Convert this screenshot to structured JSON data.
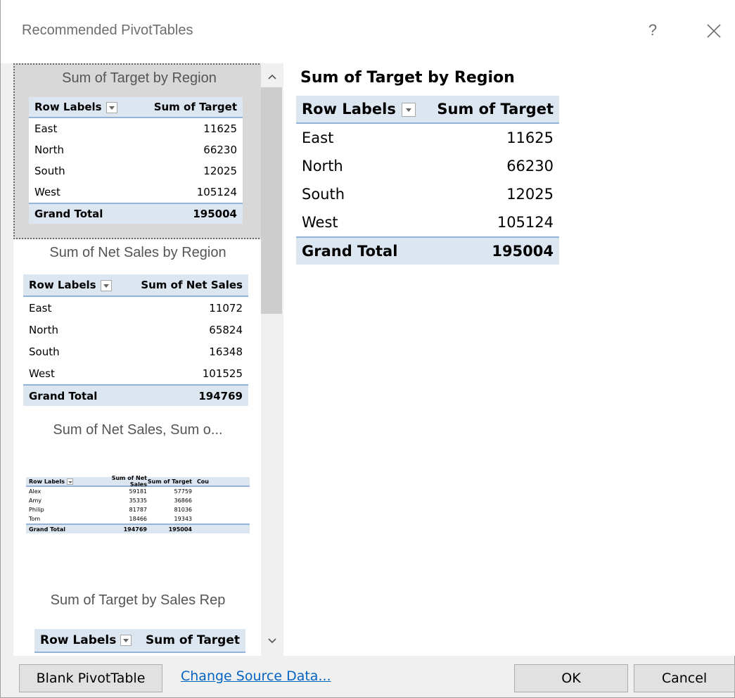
{
  "dialog": {
    "title": "Recommended PivotTables",
    "help_label": "?"
  },
  "gallery": {
    "cards": [
      {
        "title": "Sum of Target by Region",
        "header": [
          "Row Labels",
          "Sum of Target"
        ],
        "rows": [
          [
            "East",
            "11625"
          ],
          [
            "North",
            "66230"
          ],
          [
            "South",
            "12025"
          ],
          [
            "West",
            "105124"
          ]
        ],
        "total": [
          "Grand Total",
          "195004"
        ]
      },
      {
        "title": "Sum of Net Sales by Region",
        "header": [
          "Row Labels",
          "Sum of Net Sales"
        ],
        "rows": [
          [
            "East",
            "11072"
          ],
          [
            "North",
            "65824"
          ],
          [
            "South",
            "16348"
          ],
          [
            "West",
            "101525"
          ]
        ],
        "total": [
          "Grand Total",
          "194769"
        ]
      },
      {
        "title": "Sum of Net Sales, Sum o...",
        "header": [
          "Row Labels",
          "Sum of Net Sales",
          "Sum of Target",
          "Cou"
        ],
        "rows": [
          [
            "Alex",
            "59181",
            "57759"
          ],
          [
            "Amy",
            "35335",
            "36866"
          ],
          [
            "Philip",
            "81787",
            "81036"
          ],
          [
            "Tom",
            "18466",
            "19343"
          ]
        ],
        "total": [
          "Grand Total",
          "194769",
          "195004"
        ]
      },
      {
        "title": "Sum of Target by Sales Rep",
        "header": [
          "Row Labels",
          "Sum of Target"
        ]
      }
    ]
  },
  "preview": {
    "title": "Sum of Target by Region",
    "header": [
      "Row Labels",
      "Sum of Target"
    ],
    "rows": [
      [
        "East",
        "11625"
      ],
      [
        "North",
        "66230"
      ],
      [
        "South",
        "12025"
      ],
      [
        "West",
        "105124"
      ]
    ],
    "total": [
      "Grand Total",
      "195004"
    ]
  },
  "footer": {
    "blank_label": "Blank PivotTable",
    "change_source_label": "Change Source Data...",
    "ok_label": "OK",
    "cancel_label": "Cancel"
  }
}
